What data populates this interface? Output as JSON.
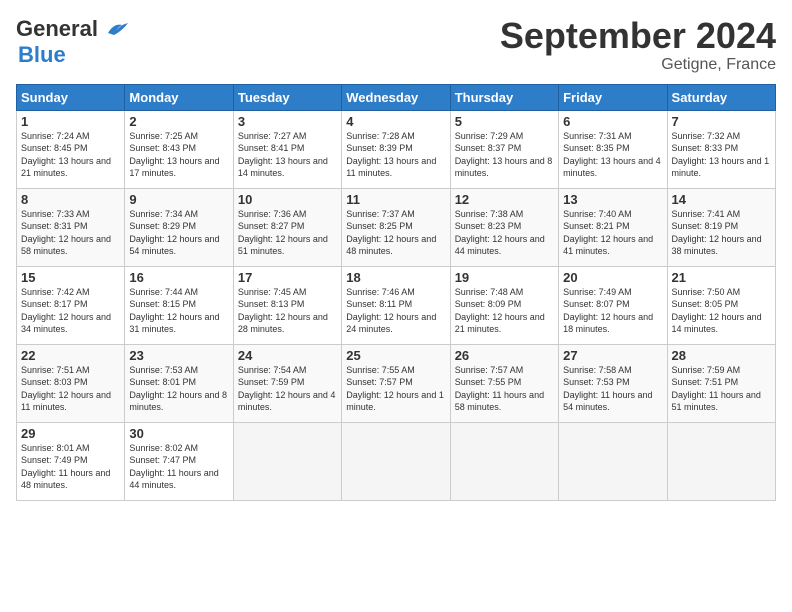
{
  "header": {
    "logo_line1": "General",
    "logo_line2": "Blue",
    "month": "September 2024",
    "location": "Getigne, France"
  },
  "days_of_week": [
    "Sunday",
    "Monday",
    "Tuesday",
    "Wednesday",
    "Thursday",
    "Friday",
    "Saturday"
  ],
  "weeks": [
    [
      {
        "day": "1",
        "sunrise": "7:24 AM",
        "sunset": "8:45 PM",
        "daylight": "13 hours and 21 minutes."
      },
      {
        "day": "2",
        "sunrise": "7:25 AM",
        "sunset": "8:43 PM",
        "daylight": "13 hours and 17 minutes."
      },
      {
        "day": "3",
        "sunrise": "7:27 AM",
        "sunset": "8:41 PM",
        "daylight": "13 hours and 14 minutes."
      },
      {
        "day": "4",
        "sunrise": "7:28 AM",
        "sunset": "8:39 PM",
        "daylight": "13 hours and 11 minutes."
      },
      {
        "day": "5",
        "sunrise": "7:29 AM",
        "sunset": "8:37 PM",
        "daylight": "13 hours and 8 minutes."
      },
      {
        "day": "6",
        "sunrise": "7:31 AM",
        "sunset": "8:35 PM",
        "daylight": "13 hours and 4 minutes."
      },
      {
        "day": "7",
        "sunrise": "7:32 AM",
        "sunset": "8:33 PM",
        "daylight": "13 hours and 1 minute."
      }
    ],
    [
      {
        "day": "8",
        "sunrise": "7:33 AM",
        "sunset": "8:31 PM",
        "daylight": "12 hours and 58 minutes."
      },
      {
        "day": "9",
        "sunrise": "7:34 AM",
        "sunset": "8:29 PM",
        "daylight": "12 hours and 54 minutes."
      },
      {
        "day": "10",
        "sunrise": "7:36 AM",
        "sunset": "8:27 PM",
        "daylight": "12 hours and 51 minutes."
      },
      {
        "day": "11",
        "sunrise": "7:37 AM",
        "sunset": "8:25 PM",
        "daylight": "12 hours and 48 minutes."
      },
      {
        "day": "12",
        "sunrise": "7:38 AM",
        "sunset": "8:23 PM",
        "daylight": "12 hours and 44 minutes."
      },
      {
        "day": "13",
        "sunrise": "7:40 AM",
        "sunset": "8:21 PM",
        "daylight": "12 hours and 41 minutes."
      },
      {
        "day": "14",
        "sunrise": "7:41 AM",
        "sunset": "8:19 PM",
        "daylight": "12 hours and 38 minutes."
      }
    ],
    [
      {
        "day": "15",
        "sunrise": "7:42 AM",
        "sunset": "8:17 PM",
        "daylight": "12 hours and 34 minutes."
      },
      {
        "day": "16",
        "sunrise": "7:44 AM",
        "sunset": "8:15 PM",
        "daylight": "12 hours and 31 minutes."
      },
      {
        "day": "17",
        "sunrise": "7:45 AM",
        "sunset": "8:13 PM",
        "daylight": "12 hours and 28 minutes."
      },
      {
        "day": "18",
        "sunrise": "7:46 AM",
        "sunset": "8:11 PM",
        "daylight": "12 hours and 24 minutes."
      },
      {
        "day": "19",
        "sunrise": "7:48 AM",
        "sunset": "8:09 PM",
        "daylight": "12 hours and 21 minutes."
      },
      {
        "day": "20",
        "sunrise": "7:49 AM",
        "sunset": "8:07 PM",
        "daylight": "12 hours and 18 minutes."
      },
      {
        "day": "21",
        "sunrise": "7:50 AM",
        "sunset": "8:05 PM",
        "daylight": "12 hours and 14 minutes."
      }
    ],
    [
      {
        "day": "22",
        "sunrise": "7:51 AM",
        "sunset": "8:03 PM",
        "daylight": "12 hours and 11 minutes."
      },
      {
        "day": "23",
        "sunrise": "7:53 AM",
        "sunset": "8:01 PM",
        "daylight": "12 hours and 8 minutes."
      },
      {
        "day": "24",
        "sunrise": "7:54 AM",
        "sunset": "7:59 PM",
        "daylight": "12 hours and 4 minutes."
      },
      {
        "day": "25",
        "sunrise": "7:55 AM",
        "sunset": "7:57 PM",
        "daylight": "12 hours and 1 minute."
      },
      {
        "day": "26",
        "sunrise": "7:57 AM",
        "sunset": "7:55 PM",
        "daylight": "11 hours and 58 minutes."
      },
      {
        "day": "27",
        "sunrise": "7:58 AM",
        "sunset": "7:53 PM",
        "daylight": "11 hours and 54 minutes."
      },
      {
        "day": "28",
        "sunrise": "7:59 AM",
        "sunset": "7:51 PM",
        "daylight": "11 hours and 51 minutes."
      }
    ],
    [
      {
        "day": "29",
        "sunrise": "8:01 AM",
        "sunset": "7:49 PM",
        "daylight": "11 hours and 48 minutes."
      },
      {
        "day": "30",
        "sunrise": "8:02 AM",
        "sunset": "7:47 PM",
        "daylight": "11 hours and 44 minutes."
      },
      null,
      null,
      null,
      null,
      null
    ]
  ],
  "labels": {
    "sunrise": "Sunrise:",
    "sunset": "Sunset:",
    "daylight": "Daylight:"
  }
}
